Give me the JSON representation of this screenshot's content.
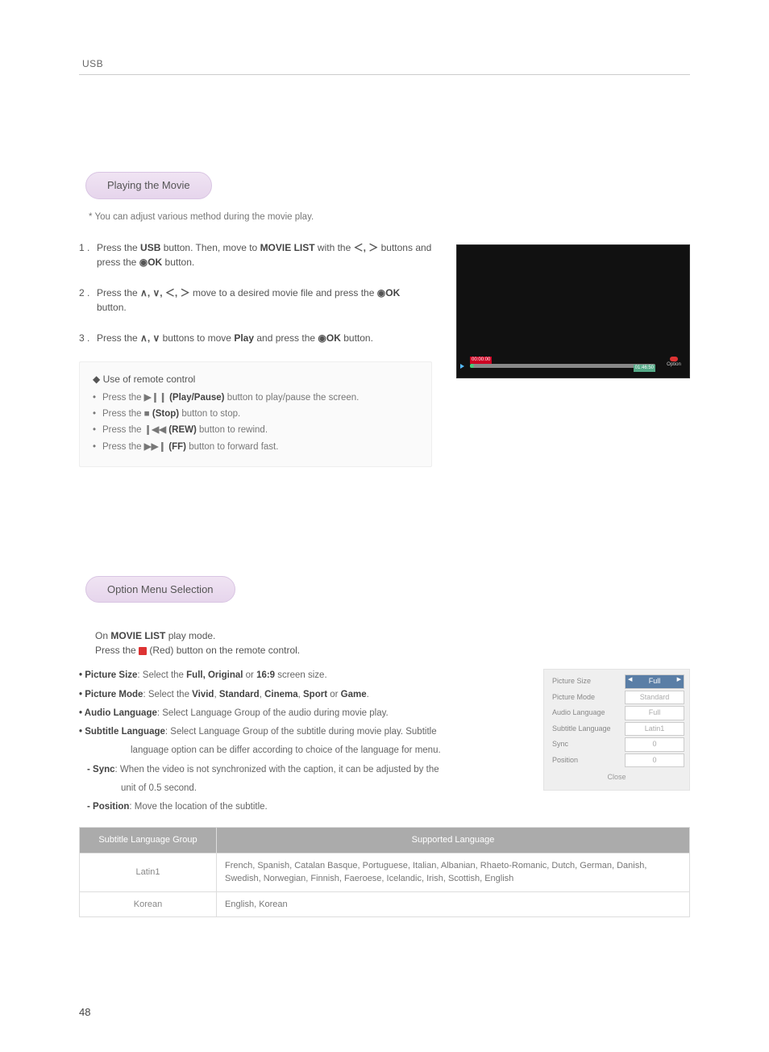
{
  "header": "USB",
  "page_number": "48",
  "sec1": {
    "title": "Playing the Movie",
    "note": "* You can adjust various method during the movie play.",
    "step1_a": "Press the ",
    "step1_b": " button. Then, move to ",
    "step1_c": " with the ",
    "step1_d": " buttons and press the ",
    "step1_e": " button.",
    "usb": "USB",
    "movielist": "MOVIE LIST",
    "arrows_lr": "＜, ＞",
    "ok_glyph": "◉",
    "ok": "OK",
    "step2_a": "Press the ",
    "step2_b": " move to a desired movie file and press the ",
    "step2_c": " button.",
    "arrows_all": "∧, ∨, ＜, ＞",
    "step3_a": "Press the ",
    "step3_b": " buttons to move ",
    "step3_c": " and press the ",
    "step3_d": " button.",
    "arrows_ud": "∧, ∨",
    "play": "Play",
    "remote_heading": "◆ Use of remote control",
    "r1_a": "Press the ",
    "r1_b": " (Play/Pause)",
    "r1_c": " button to play/pause the screen.",
    "r1_icon": "▶❙❙",
    "r2_a": "Press the ",
    "r2_b": " (Stop)",
    "r2_c": " button to stop.",
    "r2_icon": "■",
    "r3_a": "Press the ",
    "r3_b": " (REW)",
    "r3_c": " button to rewind.",
    "r3_icon": "❙◀◀",
    "r4_a": "Press the ",
    "r4_b": " (FF)",
    "r4_c": " button to forward fast.",
    "r4_icon": "▶▶❙",
    "shot": {
      "t1": "00:00:00",
      "t2": "01:46:50",
      "opt": "Option"
    }
  },
  "sec2": {
    "title": "Option Menu Selection",
    "intro_a": "On ",
    "intro_b": " play mode.",
    "intro_c": "Press the ",
    "intro_d": " (Red) button on the remote control.",
    "movielist": "MOVIE LIST",
    "b1_l": "• Picture Size",
    "b1_r": ": Select the ",
    "b1_opts": "Full, Original",
    "b1_or": " or ",
    "b1_169": "16:9",
    "b1_end": " screen size.",
    "b2_l": "• Picture Mode",
    "b2_r": ": Select the ",
    "b2_v": "Vivid",
    "b2_s": "Standard",
    "b2_c": "Cinema",
    "b2_sp": "Sport",
    "b2_g": "Game",
    "b2_sep": ", ",
    "b2_or": " or ",
    "b2_end": ".",
    "b3_l": "• Audio Language",
    "b3_r": ": Select Language Group of the audio during movie play.",
    "b4_l": "• Subtitle Language",
    "b4_r": ": Select Language Group of the subtitle during movie play. Subtitle language option can be differ according to choice of the language for menu.",
    "b5_l": "- Sync",
    "b5_r": ": When the video is not synchronized with the caption, it can be adjusted by the unit of 0.5 second.",
    "b6_l": "- Position",
    "b6_r": ": Move the location of the subtitle.",
    "panel": {
      "rows": [
        {
          "label": "Picture Size",
          "value": "Full",
          "active": true
        },
        {
          "label": "Picture Mode",
          "value": "Standard",
          "active": false
        },
        {
          "label": "Audio Language",
          "value": "Full",
          "active": false
        },
        {
          "label": "Subtitle Language",
          "value": "Latin1",
          "active": false
        },
        {
          "label": "Sync",
          "value": "0",
          "active": false
        },
        {
          "label": "Position",
          "value": "0",
          "active": false
        }
      ],
      "close": "Close"
    },
    "table": {
      "h1": "Subtitle Language Group",
      "h2": "Supported Language",
      "r1a": "Latin1",
      "r1b": "French, Spanish, Catalan Basque, Portuguese, Italian, Albanian, Rhaeto-Romanic, Dutch, German, Danish, Swedish, Norwegian, Finnish, Faeroese, Icelandic, Irish, Scottish, English",
      "r2a": "Korean",
      "r2b": "English, Korean"
    }
  }
}
